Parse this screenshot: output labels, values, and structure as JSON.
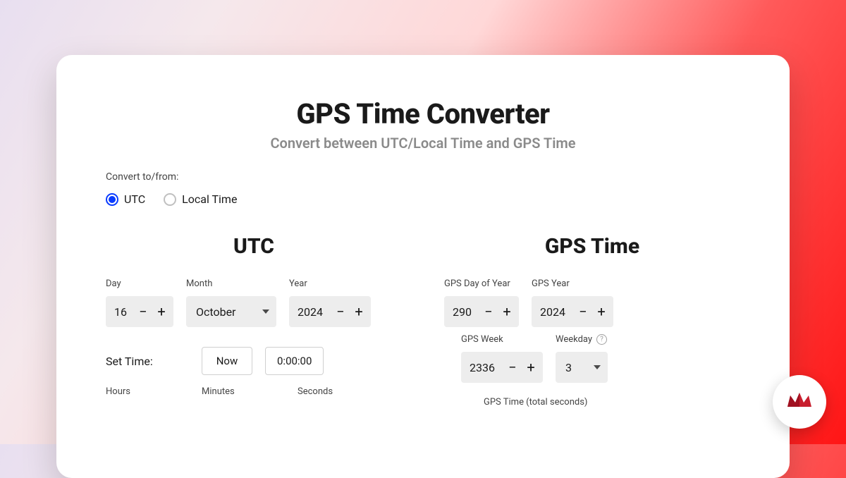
{
  "title": "GPS Time Converter",
  "subtitle": "Convert between UTC/Local Time and GPS Time",
  "convert_label": "Convert to/from:",
  "radios": {
    "utc": "UTC",
    "local": "Local Time"
  },
  "utc": {
    "heading": "UTC",
    "day_label": "Day",
    "day_value": "16",
    "month_label": "Month",
    "month_value": "October",
    "year_label": "Year",
    "year_value": "2024",
    "set_time_label": "Set Time:",
    "now_label": "Now",
    "zero_label": "0:00:00",
    "hours_label": "Hours",
    "minutes_label": "Minutes",
    "seconds_label": "Seconds"
  },
  "gps": {
    "heading": "GPS Time",
    "doy_label": "GPS Day of Year",
    "doy_value": "290",
    "year_label": "GPS Year",
    "year_value": "2024",
    "week_label": "GPS Week",
    "week_value": "2336",
    "weekday_label": "Weekday",
    "weekday_value": "3",
    "total_label": "GPS Time (total seconds)"
  }
}
